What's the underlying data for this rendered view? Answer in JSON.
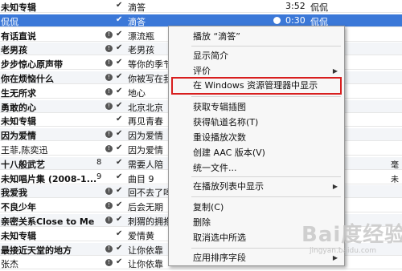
{
  "rows": [
    {
      "artist": "未知专辑",
      "bold": true,
      "num": "",
      "rating": false,
      "check": true,
      "song": "滴答",
      "time": "3:52",
      "right": "侃侃",
      "extra": ""
    },
    {
      "artist": "侃侃",
      "bold": false,
      "num": "",
      "rating": false,
      "check": true,
      "song": "滴答",
      "time": "0:30",
      "right": "侃侃",
      "extra": "",
      "selected": true
    },
    {
      "artist": "有话直说",
      "bold": true,
      "num": "",
      "rating": true,
      "check": true,
      "song": "漂流瓶",
      "time": "",
      "right": "",
      "extra": ""
    },
    {
      "artist": "老男孩",
      "bold": true,
      "num": "",
      "rating": true,
      "check": true,
      "song": "老男孩",
      "time": "",
      "right": "",
      "extra": ""
    },
    {
      "artist": "步步惊心原声带",
      "bold": true,
      "num": "",
      "rating": true,
      "check": true,
      "song": "等你的季节",
      "time": "",
      "right": "",
      "extra": ""
    },
    {
      "artist": "你在烦恼什么",
      "bold": true,
      "num": "",
      "rating": true,
      "check": true,
      "song": "你被写在我",
      "time": "",
      "right": "",
      "extra": ""
    },
    {
      "artist": "生无所求",
      "bold": true,
      "num": "",
      "rating": true,
      "check": true,
      "song": "地心",
      "time": "",
      "right": "",
      "extra": ""
    },
    {
      "artist": "勇敢的心",
      "bold": true,
      "num": "",
      "rating": true,
      "check": true,
      "song": "北京北京",
      "time": "",
      "right": "",
      "extra": ""
    },
    {
      "artist": "未知专辑",
      "bold": true,
      "num": "",
      "rating": false,
      "check": true,
      "song": "再见青春",
      "time": "",
      "right": "",
      "extra": ""
    },
    {
      "artist": "因为爱情",
      "bold": true,
      "num": "",
      "rating": true,
      "check": true,
      "song": "因为爱情",
      "time": "",
      "right": "",
      "extra": ""
    },
    {
      "artist": "王菲,陈奕迅",
      "bold": false,
      "num": "",
      "rating": true,
      "check": true,
      "song": "因为爱情",
      "time": "",
      "right": "",
      "extra": ""
    },
    {
      "artist": "十八般武艺",
      "bold": true,
      "num": "8",
      "rating": false,
      "check": true,
      "song": "需要人陪",
      "time": "",
      "right": "",
      "extra": "毫"
    },
    {
      "artist": "未知唱片集 (2008-1...",
      "bold": true,
      "num": "9",
      "rating": false,
      "check": true,
      "song": "曲目 9",
      "time": "",
      "right": "",
      "extra": "未"
    },
    {
      "artist": "我爱我",
      "bold": true,
      "num": "",
      "rating": true,
      "check": true,
      "song": "回不去了吗",
      "time": "",
      "right": "",
      "extra": ""
    },
    {
      "artist": "不良少年",
      "bold": true,
      "num": "",
      "rating": true,
      "check": true,
      "song": "后会无期",
      "time": "",
      "right": "",
      "extra": ""
    },
    {
      "artist": "亲密关系Close to Me",
      "bold": true,
      "num": "",
      "rating": true,
      "check": true,
      "song": "刺猬的拥抱",
      "time": "",
      "right": "",
      "extra": ""
    },
    {
      "artist": "未知专辑",
      "bold": true,
      "num": "",
      "rating": false,
      "check": true,
      "song": "爱情黄",
      "time": "",
      "right": "",
      "extra": ""
    },
    {
      "artist": "最接近天堂的地方",
      "bold": true,
      "num": "",
      "rating": true,
      "check": true,
      "song": "让你依靠",
      "time": "",
      "right": "",
      "extra": ""
    },
    {
      "artist": "张杰",
      "bold": false,
      "num": "",
      "rating": true,
      "check": true,
      "song": "让你依靠",
      "time": "",
      "right": "",
      "extra": ""
    }
  ],
  "menu": {
    "items": [
      {
        "label": "播放 “滴答”",
        "submenu": false
      },
      {
        "label": "显示简介",
        "submenu": false
      },
      {
        "label": "评价",
        "submenu": true
      },
      {
        "label": "在 Windows 资源管理器中显示",
        "submenu": false
      },
      {
        "label": "获取专辑插图",
        "submenu": false
      },
      {
        "label": "获得轨道名称(T)",
        "submenu": false
      },
      {
        "label": "重设播放次数",
        "submenu": false
      },
      {
        "label": "创建 AAC 版本(V)",
        "submenu": false
      },
      {
        "label": "统一文件...",
        "submenu": false
      },
      {
        "label": "在播放列表中显示",
        "submenu": true
      },
      {
        "label": "复制(C)",
        "submenu": false
      },
      {
        "label": "删除",
        "submenu": false
      },
      {
        "label": "取消选中所选",
        "submenu": false
      },
      {
        "label": "应用排序字段",
        "submenu": true
      }
    ]
  },
  "icons": {
    "rating": "info-circle-icon",
    "check": "checkmark-icon",
    "submenu": "chevron-right-icon"
  },
  "colors": {
    "selection": "#3b78d8",
    "highlight_box": "#d81e1e"
  },
  "watermark": {
    "text": "Bai度经验",
    "url": "jingyan.baidu.com"
  }
}
